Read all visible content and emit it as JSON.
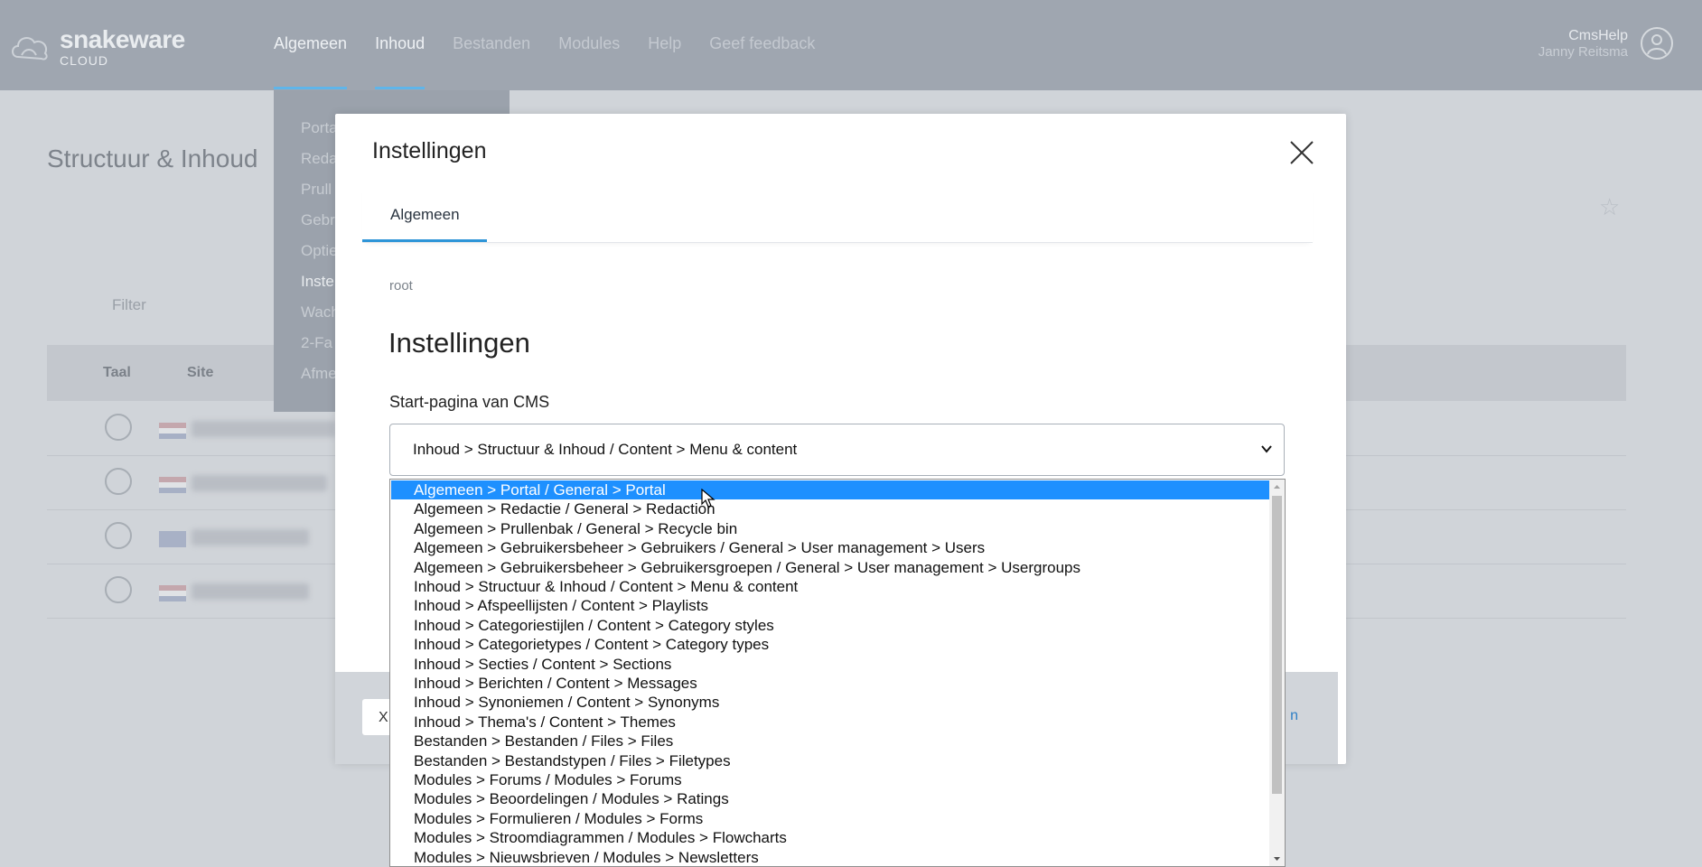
{
  "header": {
    "logo_name": "snakeware",
    "logo_sub": "CLOUD",
    "nav": [
      "Algemeen",
      "Inhoud",
      "Bestanden",
      "Modules",
      "Help",
      "Geef feedback"
    ],
    "user_name": "CmsHelp",
    "user_sub": "Janny Reitsma"
  },
  "submenu": {
    "items": [
      "Porta",
      "Reda",
      "Prull",
      "Gebr",
      "Optie",
      "Inste",
      "Wach",
      "2-Fa",
      "Afme"
    ]
  },
  "page": {
    "title": "Structuur & Inhoud",
    "filter_placeholder": "Filter",
    "columns": [
      "Taal",
      "Site"
    ]
  },
  "modal": {
    "title": "Instellingen",
    "tab": "Algemeen",
    "breadcrumb": "root",
    "section_title": "Instellingen",
    "field_label": "Start-pagina van CMS",
    "select_value": "Inhoud > Structuur & Inhoud / Content > Menu & content",
    "footer_button": "X",
    "footer_link": "n"
  },
  "dropdown": {
    "options": [
      "Algemeen > Portal / General > Portal",
      "Algemeen > Redactie / General > Redaction",
      "Algemeen > Prullenbak / General > Recycle bin",
      "Algemeen > Gebruikersbeheer > Gebruikers / General > User management > Users",
      "Algemeen > Gebruikersbeheer > Gebruikersgroepen / General > User management > Usergroups",
      "Inhoud > Structuur & Inhoud / Content > Menu & content",
      "Inhoud > Afspeellijsten / Content > Playlists",
      "Inhoud > Categoriestijlen / Content > Category styles",
      "Inhoud > Categorietypes / Content > Category types",
      "Inhoud > Secties / Content > Sections",
      "Inhoud > Berichten / Content > Messages",
      "Inhoud > Synoniemen / Content > Synonyms",
      "Inhoud > Thema's / Content > Themes",
      "Bestanden > Bestanden / Files > Files",
      "Bestanden > Bestandstypen / Files > Filetypes",
      "Modules > Forums / Modules > Forums",
      "Modules > Beoordelingen / Modules > Ratings",
      "Modules > Formulieren / Modules > Forms",
      "Modules > Stroomdiagrammen / Modules > Flowcharts",
      "Modules > Nieuwsbrieven / Modules > Newsletters"
    ],
    "selected_index": 0
  },
  "icons": {
    "logo": "cloud-logo-icon",
    "avatar": "user-avatar-icon",
    "close": "close-icon",
    "star": "star-icon",
    "globe": "globe-icon",
    "chevron": "chevron-down-icon"
  },
  "colors": {
    "accent": "#2e95d8",
    "selected_option": "#1e90ff"
  }
}
